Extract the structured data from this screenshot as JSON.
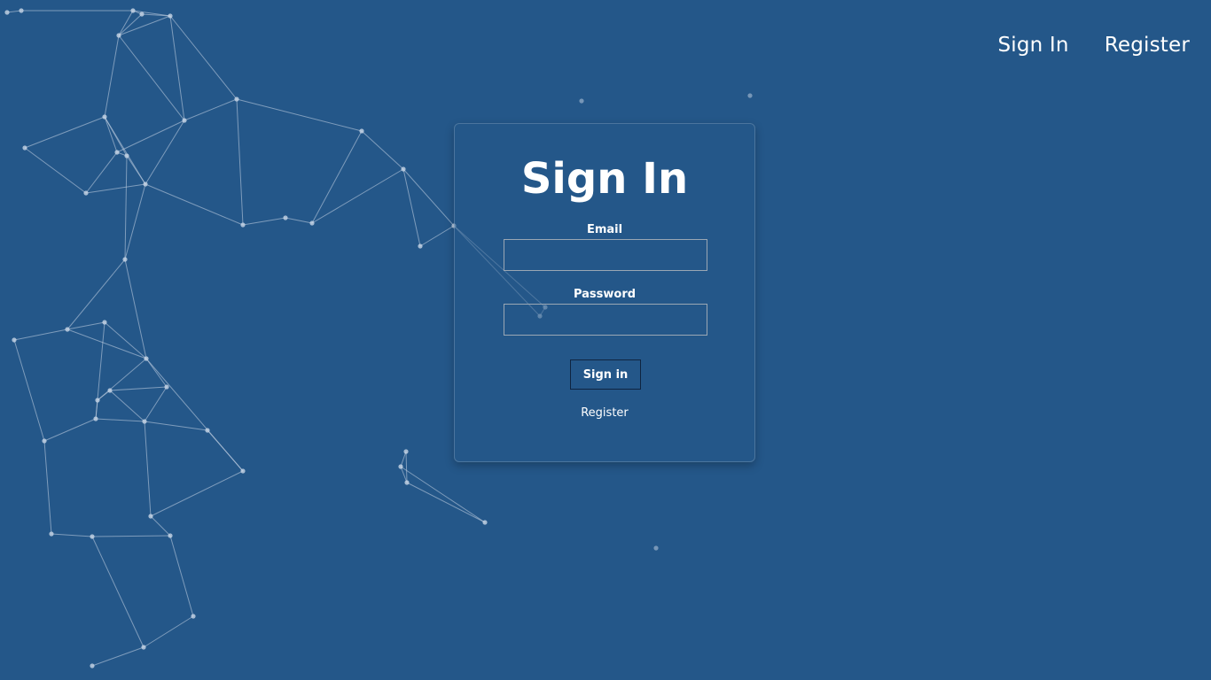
{
  "nav": {
    "signin_label": "Sign In",
    "register_label": "Register"
  },
  "form": {
    "title": "Sign In",
    "email_label": "Email",
    "email_value": "",
    "password_label": "Password",
    "password_value": "",
    "submit_label": "Sign in",
    "register_link": "Register"
  },
  "colors": {
    "background": "#245789",
    "text": "#ffffff",
    "network_line": "#c8d6e6"
  }
}
